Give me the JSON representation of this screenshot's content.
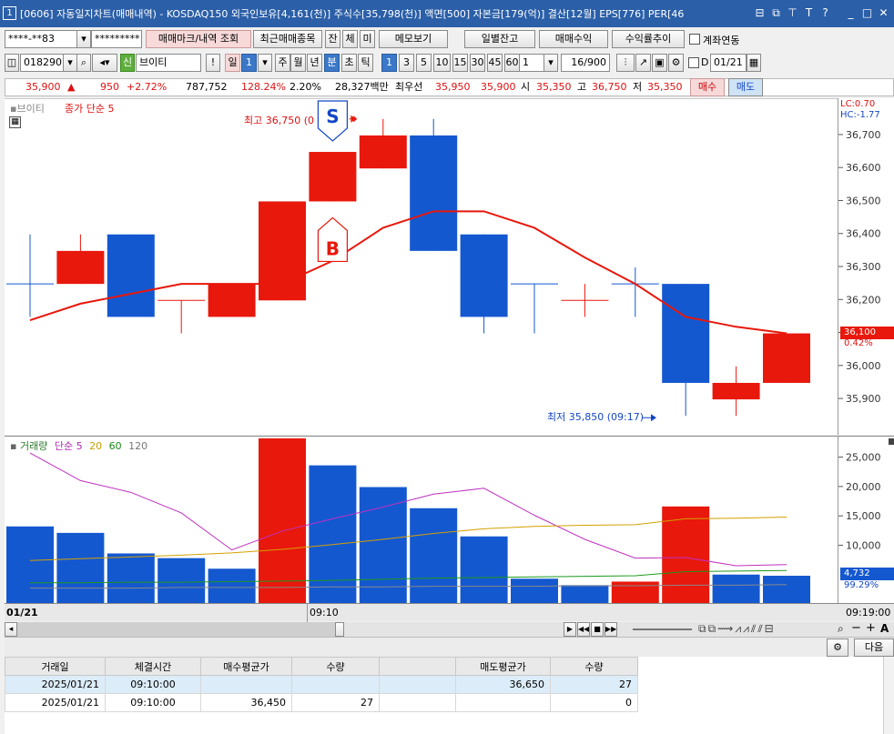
{
  "window": {
    "number": "1",
    "title": "[0606] 자동일지차트(매매내역) - KOSDAQ150 외국인보유[4,161(천)] 주식수[35,798(천)] 액면[500] 자본금[179(억)] 결산[12월] EPS[776] PER[46",
    "icons": [
      "restore-icon",
      "popup-icon",
      "pin-icon",
      "font-icon",
      "help-icon",
      "minimize-icon",
      "maximize-icon",
      "close-icon"
    ],
    "icon_glyphs": [
      "⊟",
      "⧉",
      "⊤",
      "T",
      "?",
      "_",
      "□",
      "✕"
    ]
  },
  "toolbar1": {
    "account": "****-**83",
    "password": "*********",
    "btn_mark": "매매마크/내역 조회",
    "btn_recent": "최근매매종목",
    "btn_jan": "잔",
    "btn_che": "체",
    "btn_mi": "미",
    "btn_memo": "메모보기",
    "btn_daily": "일별잔고",
    "btn_profit": "매매수익",
    "btn_rate": "수익률추이",
    "link_label": "계좌연동"
  },
  "toolbar2": {
    "code": "018290",
    "market_badge": "신",
    "name": "브이티",
    "excl": "!",
    "period_day": "일",
    "period_num": "1",
    "periods": [
      "주",
      "월",
      "년",
      "분",
      "초",
      "틱"
    ],
    "minutes": [
      "1",
      "3",
      "5",
      "10",
      "15",
      "30",
      "45",
      "60"
    ],
    "interval": "1",
    "count": "16/900",
    "d_label": "D",
    "date": "01/21"
  },
  "infobar": {
    "price": "35,900",
    "arrow": "▲",
    "change": "950",
    "change_pct": "+2.72%",
    "volume": "787,752",
    "vol_ratio": "128.24%",
    "turnover": "2.20%",
    "amount": "28,327백만",
    "best_label": "최우선",
    "ask": "35,950",
    "bid": "35,900",
    "open_label": "시",
    "open": "35,350",
    "high_label": "고",
    "high": "36,750",
    "low_label": "저",
    "low": "35,350",
    "buy_btn": "매수",
    "sell_btn": "매도"
  },
  "price_pane": {
    "tab": "브이티",
    "ma_label": "종가 단순 5",
    "high_note": "최고 36,750 (0",
    "low_note": "최저 35,850 (09:17)",
    "lc": "LC:0.70",
    "hc": "HC:-1.77",
    "cur_price": "36,100",
    "cur_pct": "0.42%",
    "sell_marker": "S",
    "buy_marker": "B",
    "up_color": "#e8180c",
    "down_color": "#1458d0"
  },
  "vol_pane": {
    "title": "거래량",
    "ma_title": "단순 5",
    "ma20": "20",
    "ma60": "60",
    "ma120": "120",
    "cur_vol": "4,732",
    "cur_pct": "99.29%"
  },
  "x_axis": {
    "left": "01/21",
    "mid": "09:10",
    "right": "09:19:00"
  },
  "chart_data": {
    "type": "candlestick",
    "price_ticks": [
      "36,700",
      "36,600",
      "36,500",
      "36,400",
      "36,300",
      "36,200",
      "36,100",
      "36,000",
      "35,900"
    ],
    "price_tick_values": [
      36700,
      36600,
      36500,
      36400,
      36300,
      36200,
      36100,
      36000,
      35900
    ],
    "price_ylim": [
      35790,
      36810
    ],
    "candles": [
      {
        "o": 36250,
        "c": 36250,
        "h": 36400,
        "l": 36150
      },
      {
        "o": 36250,
        "c": 36350,
        "h": 36400,
        "l": 36250
      },
      {
        "o": 36400,
        "c": 36150,
        "h": 36400,
        "l": 36150
      },
      {
        "o": 36200,
        "c": 36200,
        "h": 36200,
        "l": 36100
      },
      {
        "o": 36150,
        "c": 36250,
        "h": 36250,
        "l": 36150
      },
      {
        "o": 36200,
        "c": 36500,
        "h": 36500,
        "l": 36200
      },
      {
        "o": 36500,
        "c": 36650,
        "h": 36650,
        "l": 36500
      },
      {
        "o": 36600,
        "c": 36700,
        "h": 36750,
        "l": 36600
      },
      {
        "o": 36700,
        "c": 36350,
        "h": 36750,
        "l": 36350
      },
      {
        "o": 36400,
        "c": 36150,
        "h": 36400,
        "l": 36100
      },
      {
        "o": 36250,
        "c": 36250,
        "h": 36250,
        "l": 36100
      },
      {
        "o": 36200,
        "c": 36200,
        "h": 36250,
        "l": 36150
      },
      {
        "o": 36250,
        "c": 36250,
        "h": 36300,
        "l": 36150
      },
      {
        "o": 36250,
        "c": 35950,
        "h": 36250,
        "l": 35850
      },
      {
        "o": 35900,
        "c": 35950,
        "h": 36000,
        "l": 35850
      },
      {
        "o": 35950,
        "c": 36100,
        "h": 36100,
        "l": 35950
      }
    ],
    "ma5": [
      36140,
      36190,
      36220,
      36250,
      36250,
      36250,
      36320,
      36420,
      36470,
      36470,
      36420,
      36330,
      36250,
      36150,
      36120,
      36100
    ],
    "volume_ticks": [
      "25,000",
      "20,000",
      "15,000",
      "10,000"
    ],
    "volume_tick_values": [
      25000,
      20000,
      15000,
      10000
    ],
    "volume_ylim": [
      0,
      28500
    ],
    "volumes": [
      13200,
      12100,
      8600,
      7800,
      6000,
      28200,
      23600,
      19900,
      16300,
      11500,
      4300,
      3200,
      3800,
      16600,
      5000,
      4800
    ],
    "vol_ma5": [
      25700,
      21000,
      19000,
      15500,
      9200,
      12400,
      14500,
      16500,
      18700,
      19700,
      15100,
      11000,
      7800,
      7900,
      6500,
      6700
    ],
    "vol_ma20": [
      7400,
      7700,
      8000,
      8300,
      8700,
      9300,
      10100,
      11000,
      12000,
      12800,
      13200,
      13400,
      13500,
      14500,
      14600,
      14800
    ],
    "vol_ma60": [
      3600,
      3600,
      3700,
      3700,
      3800,
      3900,
      4000,
      4200,
      4400,
      4500,
      4600,
      4700,
      4800,
      5500,
      5600,
      5700
    ],
    "vol_ma120": [
      2700,
      2700,
      2700,
      2800,
      2800,
      2800,
      2900,
      2900,
      3000,
      3000,
      3000,
      3100,
      3100,
      3200,
      3200,
      3300
    ]
  },
  "bottom_toolbar": {
    "next_btn": "다음"
  },
  "trade_table": {
    "headers": [
      "거래일",
      "체결시간",
      "매수평균가",
      "수량",
      "",
      "매도평균가",
      "수량"
    ],
    "rows": [
      [
        "2025/01/21",
        "09:10:00",
        "",
        "",
        "",
        "36,650",
        "27"
      ],
      [
        "2025/01/21",
        "09:10:00",
        "36,450",
        "27",
        "",
        "",
        "0"
      ]
    ]
  }
}
